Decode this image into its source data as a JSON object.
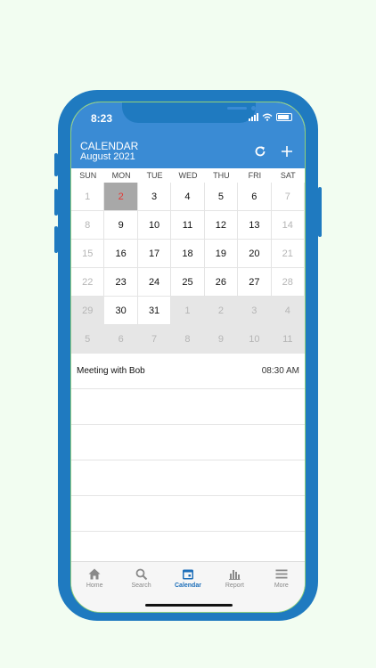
{
  "status": {
    "time": "8:23"
  },
  "header": {
    "title": "CALENDAR",
    "subtitle": "August 2021"
  },
  "weekdays": [
    "SUN",
    "MON",
    "TUE",
    "WED",
    "THU",
    "FRI",
    "SAT"
  ],
  "weeks": [
    [
      "1",
      "2",
      "3",
      "4",
      "5",
      "6",
      "7"
    ],
    [
      "8",
      "9",
      "10",
      "11",
      "12",
      "13",
      "14"
    ],
    [
      "15",
      "16",
      "17",
      "18",
      "19",
      "20",
      "21"
    ],
    [
      "22",
      "23",
      "24",
      "25",
      "26",
      "27",
      "28"
    ],
    [
      "29",
      "30",
      "31",
      "1",
      "2",
      "3",
      "4"
    ],
    [
      "5",
      "6",
      "7",
      "8",
      "9",
      "10",
      "11"
    ]
  ],
  "events": [
    {
      "title": "Meeting with Bob",
      "time": "08:30 AM"
    }
  ],
  "tabs": [
    "Home",
    "Search",
    "Calendar",
    "Report",
    "More"
  ],
  "colors": {
    "accent": "#3a8bd4",
    "frame": "#1f7ac0",
    "today": "#e53935"
  }
}
